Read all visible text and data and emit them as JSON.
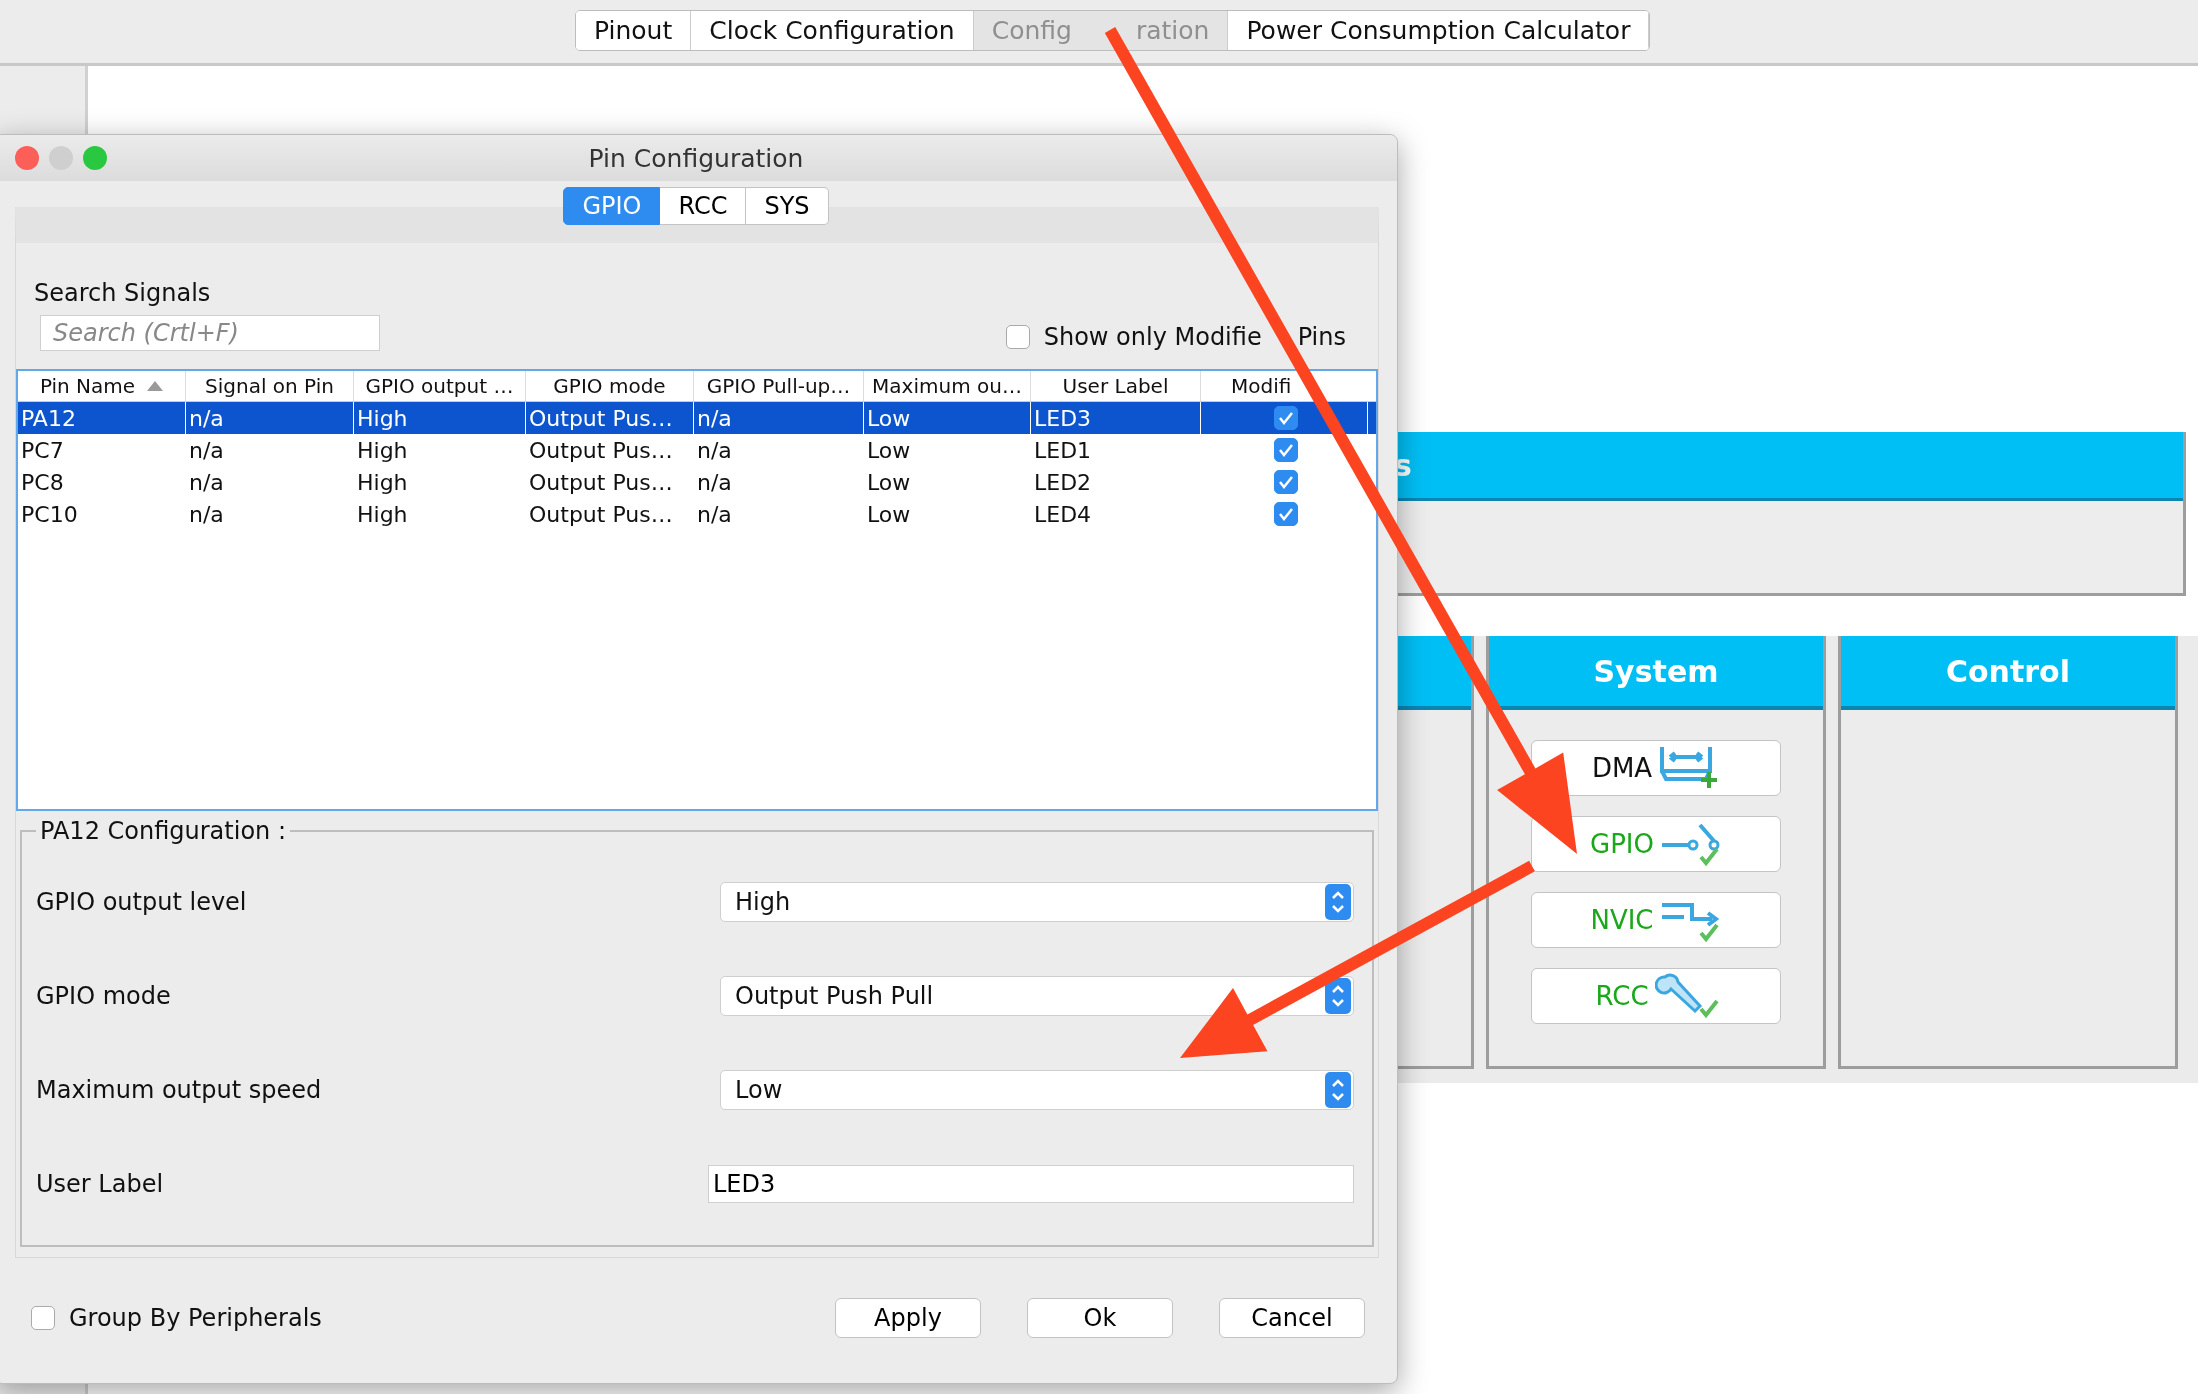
{
  "app_tabs": [
    {
      "label": "Pinout",
      "selected": false
    },
    {
      "label": "Clock Configuration",
      "selected": false
    },
    {
      "label_parts": [
        "Config",
        "ration"
      ],
      "selected": true
    },
    {
      "label": "Power Consumption Calculator",
      "selected": false
    }
  ],
  "category_bar_fragment": "s",
  "categories": [
    {
      "title": "System",
      "items": [
        {
          "name": "DMA",
          "kind": "dma",
          "configured": false
        },
        {
          "name": "GPIO",
          "kind": "gpio",
          "configured": true
        },
        {
          "name": "NVIC",
          "kind": "nvic",
          "configured": true
        },
        {
          "name": "RCC",
          "kind": "rcc",
          "configured": true
        }
      ]
    },
    {
      "title": "Control"
    }
  ],
  "dialog": {
    "title": "Pin Configuration",
    "tabs": [
      {
        "label": "GPIO",
        "selected": true
      },
      {
        "label": "RCC",
        "selected": false
      },
      {
        "label": "SYS",
        "selected": false
      }
    ],
    "search": {
      "label": "Search Signals",
      "placeholder": "Search (Crtl+F)"
    },
    "show_only_modified": {
      "label_parts": [
        "Show only Modifie",
        "Pins"
      ],
      "checked": false
    },
    "table": {
      "columns": [
        {
          "label": "Pin Name",
          "sorted": true
        },
        {
          "label": "Signal on Pin",
          "sorted": false
        },
        {
          "label": "GPIO output …",
          "sorted": false
        },
        {
          "label": "GPIO mode",
          "sorted": false
        },
        {
          "label": "GPIO Pull-up…",
          "sorted": false
        },
        {
          "label": "Maximum ou…",
          "sorted": false
        },
        {
          "label": "User Label",
          "sorted": false
        },
        {
          "label": "Modifi",
          "sorted": false
        }
      ],
      "rows": [
        {
          "cells": [
            "PA12",
            "n/a",
            "High",
            "Output Pus…",
            "n/a",
            "Low",
            "LED3"
          ],
          "modified": true,
          "selected": true
        },
        {
          "cells": [
            "PC7",
            "n/a",
            "High",
            "Output Pus…",
            "n/a",
            "Low",
            "LED1"
          ],
          "modified": true,
          "selected": false
        },
        {
          "cells": [
            "PC8",
            "n/a",
            "High",
            "Output Pus…",
            "n/a",
            "Low",
            "LED2"
          ],
          "modified": true,
          "selected": false
        },
        {
          "cells": [
            "PC10",
            "n/a",
            "High",
            "Output Pus…",
            "n/a",
            "Low",
            "LED4"
          ],
          "modified": true,
          "selected": false
        }
      ]
    },
    "config": {
      "title": "PA12 Configuration :",
      "fields": [
        {
          "kind": "select",
          "label": "GPIO output level",
          "value": "High"
        },
        {
          "kind": "select",
          "label": "GPIO mode",
          "value": "Output Push Pull"
        },
        {
          "kind": "select",
          "label": "Maximum output speed",
          "value": "Low"
        },
        {
          "kind": "text",
          "label": "User Label",
          "value": "LED3"
        }
      ]
    },
    "group_by_peripherals": {
      "label": "Group By Peripherals",
      "checked": false
    },
    "buttons": [
      "Apply",
      "Ok",
      "Cancel"
    ]
  }
}
